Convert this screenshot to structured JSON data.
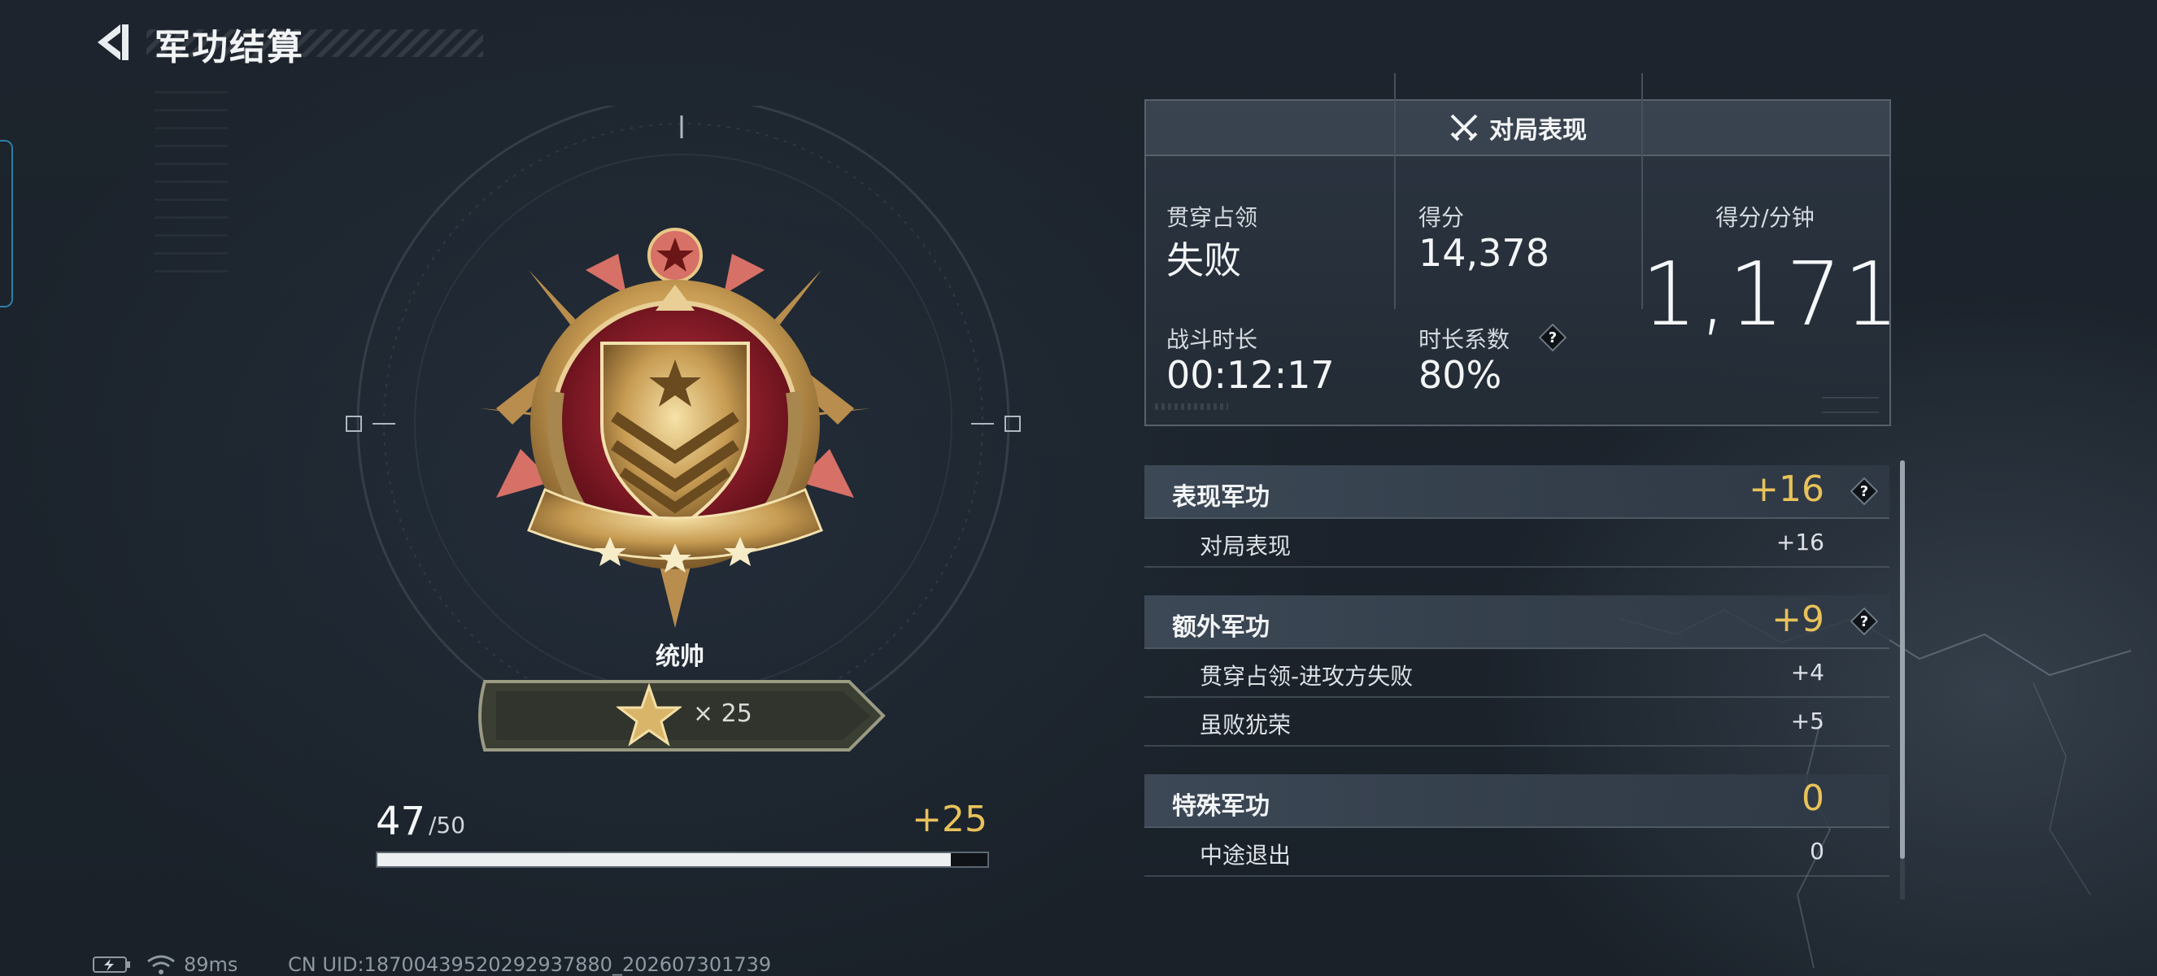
{
  "header": {
    "title": "军功结算",
    "back_icon": "back-arrow-icon"
  },
  "medal": {
    "rank_name": "统帅",
    "stars_label": "× 25",
    "icon": "rank-medal-icon"
  },
  "progress": {
    "current": "47",
    "max": "/50",
    "gain": "+25",
    "fraction": 0.94
  },
  "performance": {
    "title": "对局表现",
    "stats": {
      "mode_label": "贯穿占领",
      "mode_value": "失败",
      "score_label": "得分",
      "score_value": "14,378",
      "duration_label": "战斗时长",
      "duration_value": "00:12:17",
      "coef_label": "时长系数",
      "coef_value": "80%",
      "spm_label": "得分/分钟",
      "spm_value": "1,171"
    }
  },
  "merits": [
    {
      "title": "表现军功",
      "total": "+16",
      "has_help": true,
      "rows": [
        {
          "label": "对局表现",
          "value": "+16"
        }
      ]
    },
    {
      "title": "额外军功",
      "total": "+9",
      "has_help": true,
      "rows": [
        {
          "label": "贯穿占领-进攻方失败",
          "value": "+4"
        },
        {
          "label": "虽败犹荣",
          "value": "+5"
        }
      ]
    },
    {
      "title": "特殊军功",
      "total": "0",
      "has_help": false,
      "rows": [
        {
          "label": "中途退出",
          "value": "0"
        }
      ]
    }
  ],
  "status": {
    "ping": "89ms",
    "uid": "CN UID:18700439520292937880_202607301739"
  },
  "colors": {
    "accent_gold": "#e8c25a",
    "panel_border": "#56616b",
    "background": "#1b222b"
  }
}
